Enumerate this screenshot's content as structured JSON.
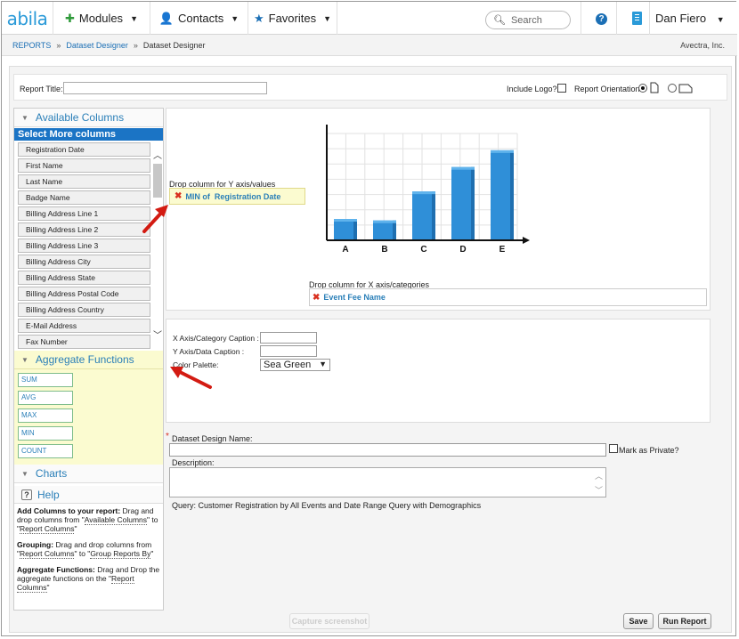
{
  "app": {
    "logo": "abila",
    "nav": [
      {
        "label": "Modules",
        "icon": "puzzle-icon"
      },
      {
        "label": "Contacts",
        "icon": "person-icon"
      },
      {
        "label": "Favorites",
        "icon": "star-icon"
      }
    ],
    "search_placeholder": "Search",
    "user": "Dan Fiero"
  },
  "breadcrumb": {
    "items": [
      "REPORTS",
      "Dataset Designer"
    ],
    "current": "Dataset Designer",
    "company": "Avectra, Inc."
  },
  "report": {
    "title_label": "Report Title:",
    "title_value": "",
    "include_logo_label": "Include Logo?",
    "orientation_label": "Report Orientation:"
  },
  "left": {
    "available_header": "Available Columns",
    "select_more": "Select More columns",
    "columns": [
      "Registration Date",
      "First Name",
      "Last Name",
      "Badge Name",
      "Billing Address Line 1",
      "Billing Address Line 2",
      "Billing Address Line 3",
      "Billing Address City",
      "Billing Address State",
      "Billing Address Postal Code",
      "Billing Address Country",
      "E-Mail Address",
      "Fax Number"
    ],
    "aggregate_header": "Aggregate Functions",
    "aggregates": [
      "SUM",
      "AVG",
      "MAX",
      "MIN",
      "COUNT"
    ],
    "charts_header": "Charts",
    "help_header": "Help",
    "help": {
      "p1_bold": "Add Columns to your report:",
      "p1_text": " Drag and drop columns from \"",
      "p1_link1": "Available Columns",
      "p1_mid": "\" to \"",
      "p1_link2": "Report Columns",
      "p1_end": "\"",
      "p2_bold": "Grouping:",
      "p2_text": " Drag and drop columns from \"",
      "p2_link1": "Report Columns",
      "p2_mid": "\" to \"",
      "p2_link2": "Group Reports By",
      "p2_end": "\"",
      "p3_bold": "Aggregate Functions:",
      "p3_text": " Drag and Drop the aggregate functions on the \"",
      "p3_link": "Report Columns",
      "p3_end": "\""
    }
  },
  "chart": {
    "dropY_label": "Drop column for Y axis/values",
    "dropY_value_prefix": "MIN of",
    "dropY_value": "Registration Date",
    "dropX_label": "Drop column for X axis/categories",
    "dropX_value": "Event Fee Name",
    "bar_color": "#2f8fd8"
  },
  "chart_data": {
    "type": "bar",
    "categories": [
      "A",
      "B",
      "C",
      "D",
      "E"
    ],
    "values": [
      1.4,
      1.3,
      3.2,
      4.8,
      5.9
    ],
    "ylim": [
      0,
      7
    ],
    "grid": true
  },
  "captions": {
    "x_label": "X Axis/Category Caption :",
    "y_label": "Y Axis/Data Caption :",
    "palette_label": "Color Palette:",
    "palette_value": "Sea Green"
  },
  "dataset": {
    "name_label": "Dataset Design Name:",
    "private_label": "Mark as Private?",
    "description_label": "Description:",
    "query_text": "Query: Customer Registration by All Events and Date Range Query with Demographics"
  },
  "footer": {
    "capture_label": "Capture screenshot",
    "save_label": "Save",
    "run_label": "Run Report"
  }
}
